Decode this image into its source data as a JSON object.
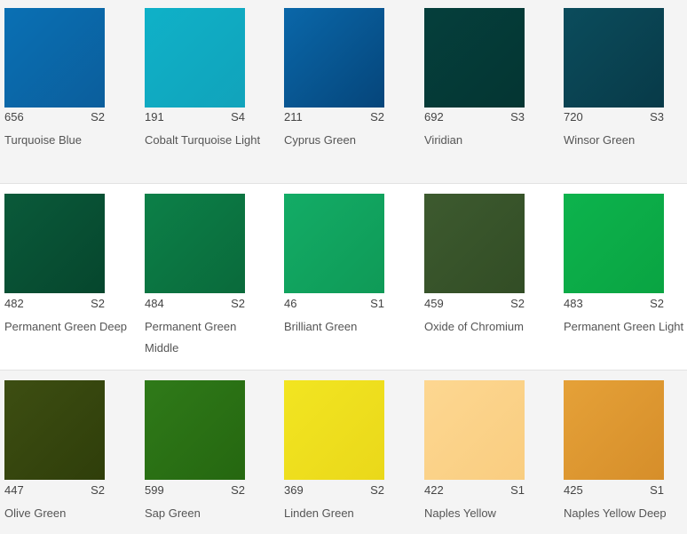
{
  "rows": [
    [
      {
        "code": "656",
        "series": "S2",
        "name": "Turquoise Blue",
        "color": "#0a70b4",
        "color2": "#0b5e9c"
      },
      {
        "code": "191",
        "series": "S4",
        "name": "Cobalt Turquoise Light",
        "color": "#0fb1c8",
        "color2": "#11a3bb"
      },
      {
        "code": "211",
        "series": "S2",
        "name": "Cyprus Green",
        "color": "#0a67a9",
        "color2": "#05457a"
      },
      {
        "code": "692",
        "series": "S3",
        "name": "Viridian",
        "color": "#053f3c",
        "color2": "#043532"
      },
      {
        "code": "720",
        "series": "S3",
        "name": "Winsor Green",
        "color": "#0b4c5c",
        "color2": "#083a48"
      }
    ],
    [
      {
        "code": "482",
        "series": "S2",
        "name": "Permanent Green Deep",
        "color": "#0a5a3a",
        "color2": "#06462d"
      },
      {
        "code": "484",
        "series": "S2",
        "name": "Permanent Green Middle",
        "color": "#0c8048",
        "color2": "#0a6a3b"
      },
      {
        "code": "46",
        "series": "S1",
        "name": "Brilliant Green",
        "color": "#13ac66",
        "color2": "#0f9a57"
      },
      {
        "code": "459",
        "series": "S2",
        "name": "Oxide of Chromium",
        "color": "#3d5a2f",
        "color2": "#324d25"
      },
      {
        "code": "483",
        "series": "S2",
        "name": "Permanent Green Light",
        "color": "#0db34d",
        "color2": "#0aa442"
      }
    ],
    [
      {
        "code": "447",
        "series": "S2",
        "name": "Olive Green",
        "color": "#3d4e12",
        "color2": "#2f3e0a"
      },
      {
        "code": "599",
        "series": "S2",
        "name": "Sap Green",
        "color": "#2f7a19",
        "color2": "#256710"
      },
      {
        "code": "369",
        "series": "S2",
        "name": "Linden Green",
        "color": "#f2e521",
        "color2": "#ead81a"
      },
      {
        "code": "422",
        "series": "S1",
        "name": "Naples Yellow",
        "color": "#fdd791",
        "color2": "#f9cd80"
      },
      {
        "code": "425",
        "series": "S1",
        "name": "Naples Yellow Deep",
        "color": "#e5a138",
        "color2": "#d68e2a"
      }
    ]
  ]
}
